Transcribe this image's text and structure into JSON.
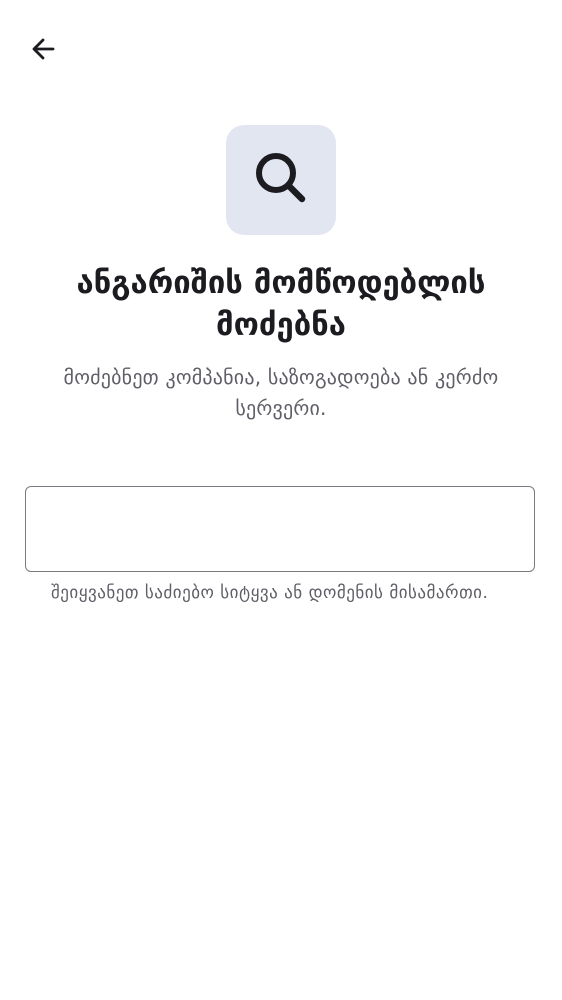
{
  "header": {
    "back_icon": "arrow-left-icon"
  },
  "hero": {
    "icon": "search-icon",
    "icon_background": "#e2e6f0"
  },
  "title": "ანგარიშის მომწოდებლის მოძებნა",
  "subtitle": "მოძებნეთ კომპანია, საზოგადოება ან კერძო სერვერი.",
  "search": {
    "value": "",
    "placeholder": ""
  },
  "helper_text": "შეიყვანეთ საძიებო სიტყვა ან დომენის მისამართი.",
  "colors": {
    "primary_text": "#1c1b20",
    "secondary_text": "#5d5e66",
    "field_border": "#7a7b80"
  }
}
